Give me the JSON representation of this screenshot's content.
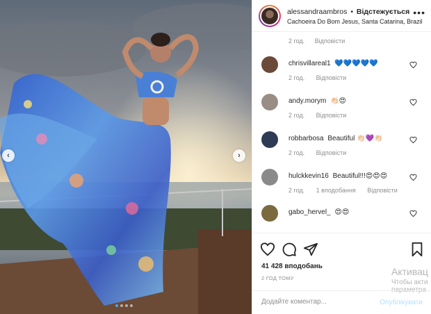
{
  "post": {
    "username": "alessandraambros",
    "separator": "•",
    "follow_status": "Відстежується",
    "location": "Cachoeira Do Bom Jesus, Santa Catarina, Brazil"
  },
  "comments": {
    "top_meta": {
      "time": "2 год.",
      "reply": "Відповісти"
    },
    "items": [
      {
        "username": "chrisvillareal1",
        "text": "💙💙💙💙💙",
        "time": "2 год.",
        "likes": "",
        "reply": "Відповісти",
        "avatar_color": "#6b4a3a"
      },
      {
        "username": "andy.morym",
        "text": "👏🏻😍",
        "time": "2 год.",
        "likes": "",
        "reply": "Відповісти",
        "avatar_color": "#9a8d86"
      },
      {
        "username": "robbarbosa",
        "text": "Beautiful 👏🏻💜👏🏻",
        "time": "2 год.",
        "likes": "",
        "reply": "Відповісти",
        "avatar_color": "#2e3b55"
      },
      {
        "username": "hulckkevin16",
        "text": "Beautiful!!!😍😍😍",
        "time": "2 год.",
        "likes": "1 вподобання",
        "reply": "Відповісти",
        "avatar_color": "#8a8a8a"
      },
      {
        "username": "gabo_hervel_",
        "text": "😍😍",
        "time": "",
        "likes": "",
        "reply": "",
        "avatar_color": "#7a6a3e"
      }
    ]
  },
  "actions": {
    "likes_count": "41 428 вподобань",
    "time_ago": "2 ГОД ТОМУ"
  },
  "add_comment": {
    "placeholder": "Додайте коментар...",
    "publish": "Опублікувати"
  },
  "watermark": {
    "line1": "Активац",
    "line2": "Чтобы акти",
    "line3": "параметра"
  },
  "carousel": {
    "slides": 4,
    "active_index": 0
  },
  "colors": {
    "accent": "#4ba3f5",
    "heart_outline": "#262626",
    "muted": "#8e8e8e"
  }
}
